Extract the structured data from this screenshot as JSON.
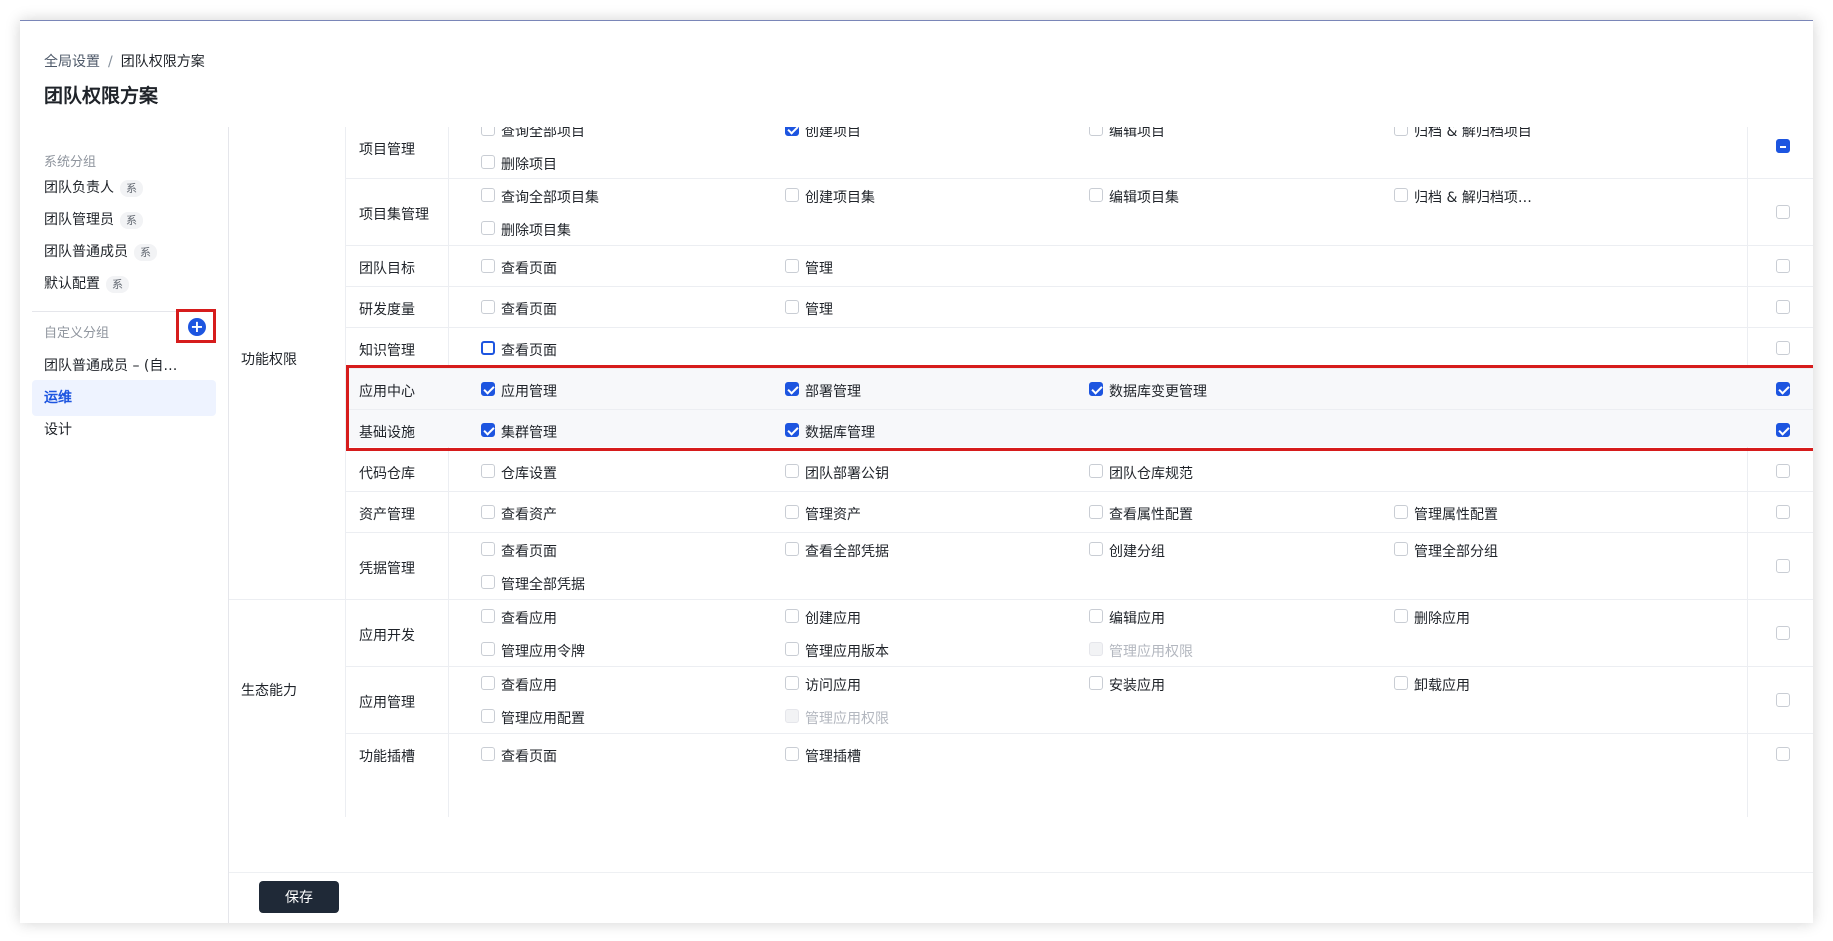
{
  "breadcrumb": {
    "root": "全局设置",
    "sep": "/",
    "current": "团队权限方案"
  },
  "page_title": "团队权限方案",
  "sidebar": {
    "system_group_title": "系统分组",
    "system_items": [
      {
        "label": "团队负责人",
        "tag": "系"
      },
      {
        "label": "团队管理员",
        "tag": "系"
      },
      {
        "label": "团队普通成员",
        "tag": "系"
      },
      {
        "label": "默认配置",
        "tag": "系"
      }
    ],
    "custom_group_title": "自定义分组",
    "add_label": "+",
    "custom_items": [
      {
        "label": "团队普通成员 – (自…"
      },
      {
        "label": "运维",
        "active": true
      },
      {
        "label": "设计"
      }
    ]
  },
  "categories": {
    "func": "功能权限",
    "eco": "生态能力"
  },
  "rows": {
    "project": {
      "name": "项目管理",
      "p1": "查询全部项目",
      "p2": "创建项目",
      "p3": "编辑项目",
      "p4": "归档 & 解归档项目",
      "p5": "删除项目"
    },
    "projset": {
      "name": "项目集管理",
      "p1": "查询全部项目集",
      "p2": "创建项目集",
      "p3": "编辑项目集",
      "p4": "归档 & 解归档项…",
      "p5": "删除项目集"
    },
    "goal": {
      "name": "团队目标",
      "p1": "查看页面",
      "p2": "管理"
    },
    "metric": {
      "name": "研发度量",
      "p1": "查看页面",
      "p2": "管理"
    },
    "knowledge": {
      "name": "知识管理",
      "p1": "查看页面"
    },
    "appcenter": {
      "name": "应用中心",
      "p1": "应用管理",
      "p2": "部署管理",
      "p3": "数据库变更管理"
    },
    "infra": {
      "name": "基础设施",
      "p1": "集群管理",
      "p2": "数据库管理"
    },
    "repo": {
      "name": "代码仓库",
      "p1": "仓库设置",
      "p2": "团队部署公钥",
      "p3": "团队仓库规范"
    },
    "asset": {
      "name": "资产管理",
      "p1": "查看资产",
      "p2": "管理资产",
      "p3": "查看属性配置",
      "p4": "管理属性配置"
    },
    "cred": {
      "name": "凭据管理",
      "p1": "查看页面",
      "p2": "查看全部凭据",
      "p3": "创建分组",
      "p4": "管理全部分组",
      "p5": "管理全部凭据"
    },
    "appdev": {
      "name": "应用开发",
      "p1": "查看应用",
      "p2": "创建应用",
      "p3": "编辑应用",
      "p4": "删除应用",
      "p5": "管理应用令牌",
      "p6": "管理应用版本",
      "p7": "管理应用权限"
    },
    "appmgmt": {
      "name": "应用管理",
      "p1": "查看应用",
      "p2": "访问应用",
      "p3": "安装应用",
      "p4": "卸载应用",
      "p5": "管理应用配置",
      "p6": "管理应用权限"
    },
    "slot": {
      "name": "功能插槽",
      "p1": "查看页面",
      "p2": "管理插槽"
    }
  },
  "save_label": "保存",
  "colors": {
    "accent": "#1d55e0",
    "highlight": "#d61c1c",
    "save_bg": "#1f2937"
  }
}
